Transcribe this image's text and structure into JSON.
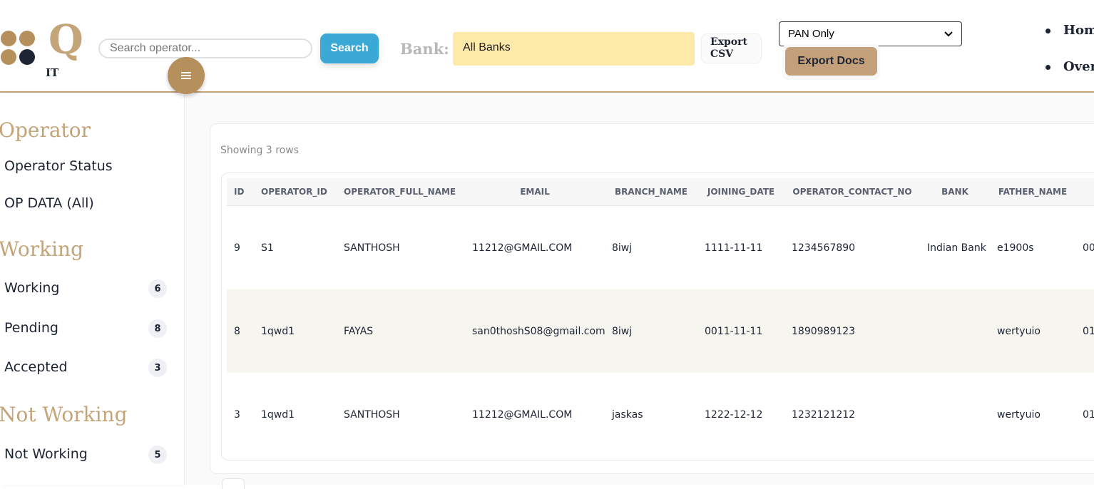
{
  "header": {
    "logo_letter": "Q",
    "logo_sub": "IT",
    "search_placeholder": "Search operator...",
    "search_button": "Search",
    "menu_icon": "≡",
    "bank_label": "Bank:",
    "bank_value": "All Banks",
    "export_csv": "Export\nCSV",
    "export_type": "PAN Only",
    "export_docs": "Export Docs",
    "nav": [
      "Hom",
      "Over"
    ]
  },
  "sidebar": {
    "sections": [
      {
        "title": "Operator",
        "items": [
          {
            "label": "Operator Status"
          },
          {
            "label": "OP DATA (All)"
          }
        ]
      },
      {
        "title": "Working",
        "items": [
          {
            "label": "Working",
            "count": "6"
          },
          {
            "label": "Pending",
            "count": "8"
          },
          {
            "label": "Accepted",
            "count": "3"
          }
        ]
      },
      {
        "title": "Not Working",
        "items": [
          {
            "label": "Not Working",
            "count": "5"
          }
        ]
      }
    ]
  },
  "table": {
    "showing": "Showing 3 rows",
    "columns": [
      "ID",
      "OPERATOR_ID",
      "OPERATOR_FULL_NAME",
      "EMAIL",
      "BRANCH_NAME",
      "JOINING_DATE",
      "OPERATOR_CONTACT_NO",
      "BANK",
      "FATHER_NAME",
      ""
    ],
    "rows": [
      [
        "9",
        "S1",
        "SANTHOSH",
        "11212@GMAIL.COM",
        "8iwj",
        "1111-11-11",
        "1234567890",
        "Indian Bank",
        "e1900s",
        "00"
      ],
      [
        "8",
        "1qwd1",
        "FAYAS",
        "san0thoshS08@gmail.com",
        "8iwj",
        "0011-11-11",
        "1890989123",
        "",
        "wertyuio",
        "01"
      ],
      [
        "3",
        "1qwd1",
        "SANTHOSH",
        "11212@GMAIL.COM",
        "jaskas",
        "1222-12-12",
        "1232121212",
        "",
        "wertyuio",
        "01"
      ]
    ]
  },
  "colors": {
    "gold": "#c4a479",
    "accent_blue": "#3aa9d6",
    "bank_bg": "#fde9a8",
    "navy": "#1d2433"
  }
}
